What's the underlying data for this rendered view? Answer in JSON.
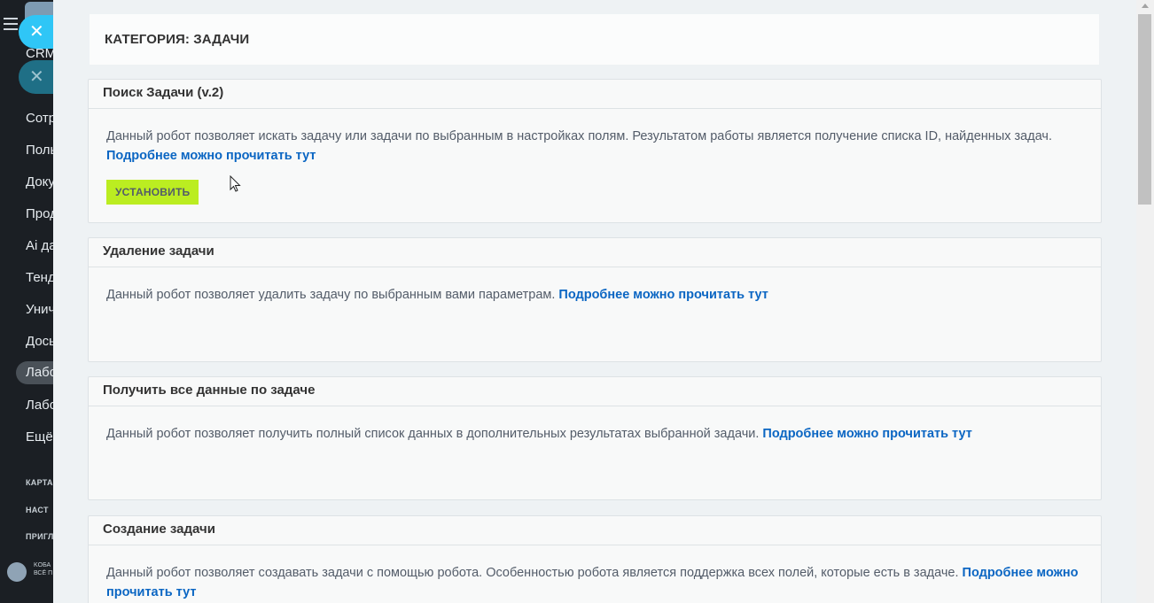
{
  "background_sidebar": {
    "crm_label": "CRM",
    "items": [
      "Сотр",
      "Поль",
      "Доку",
      "Прод",
      "Ai да",
      "Тенд",
      "Унич",
      "Дось",
      "Лабо",
      "Лабо",
      "Ещё"
    ],
    "sections": [
      "КАРТА",
      "НАСТ",
      "ПРИГЛ"
    ],
    "logo_text_1": "KOБА",
    "logo_text_2": "ВСЁ П"
  },
  "slider": {
    "close_icon": "✕",
    "category_title": "КАТЕГОРИЯ: ЗАДАЧИ",
    "cards": [
      {
        "title": "Поиск Задачи (v.2)",
        "description": "Данный робот позволяет искать задачу или задачи по выбранным в настройках полям. Результатом работы является получение списка ID, найденных задач.",
        "link_text": "Подробнее можно прочитать тут",
        "button_label": "УСТАНОВИТЬ"
      },
      {
        "title": "Удаление задачи",
        "description": "Данный робот позволяет удалить задачу по выбранным вами параметрам.",
        "link_text": "Подробнее можно прочитать тут"
      },
      {
        "title": "Получить все данные по задаче",
        "description": "Данный робот позволяет получить полный список данных в дополнительных результатах выбранной задачи.",
        "link_text": "Подробнее можно прочитать тут"
      },
      {
        "title": "Создание задачи",
        "description": "Данный робот позволяет создавать задачи с помощью робота. Особенностью робота является поддержка всех полей, которые есть в задаче.",
        "link_text": "Подробнее можно прочитать тут"
      }
    ]
  },
  "colors": {
    "install_button": "#bbed21",
    "link": "#0b66c3",
    "close_button": "#2fc6f6"
  }
}
